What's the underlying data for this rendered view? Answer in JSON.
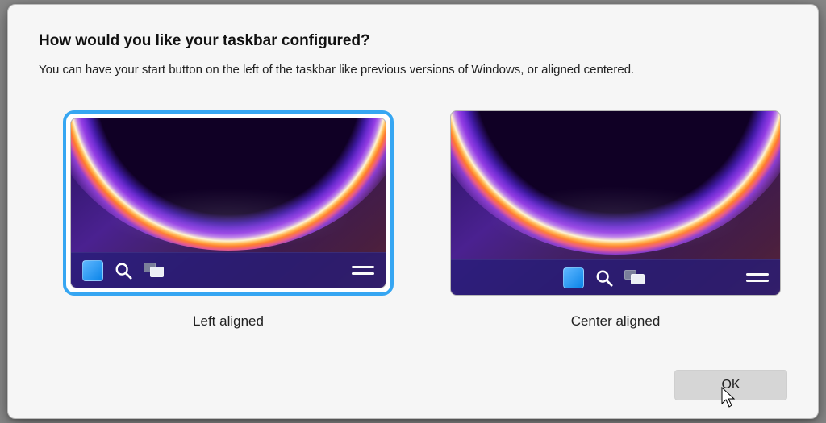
{
  "dialog": {
    "title": "How would you like your taskbar configured?",
    "subtitle": "You can have your start button on the left of the taskbar like previous versions of Windows, or aligned centered."
  },
  "options": {
    "left": {
      "label": "Left aligned",
      "selected": true
    },
    "center": {
      "label": "Center aligned",
      "selected": false
    }
  },
  "buttons": {
    "ok": "OK"
  }
}
